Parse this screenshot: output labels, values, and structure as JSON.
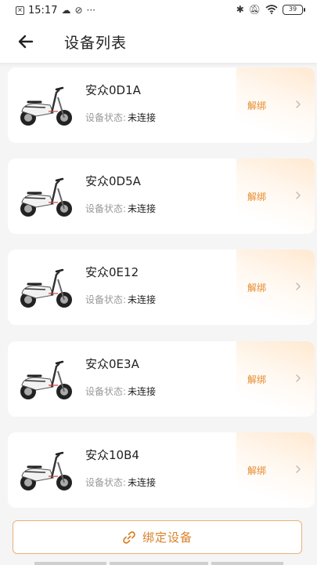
{
  "status_bar": {
    "time": "15:17",
    "extra": "···",
    "battery": "39"
  },
  "header": {
    "title": "设备列表"
  },
  "devices": [
    {
      "name": "安众0D1A",
      "status_label": "设备状态:",
      "status_value": "未连接",
      "unbind_label": "解绑"
    },
    {
      "name": "安众0D5A",
      "status_label": "设备状态:",
      "status_value": "未连接",
      "unbind_label": "解绑"
    },
    {
      "name": "安众0E12",
      "status_label": "设备状态:",
      "status_value": "未连接",
      "unbind_label": "解绑"
    },
    {
      "name": "安众0E3A",
      "status_label": "设备状态:",
      "status_value": "未连接",
      "unbind_label": "解绑"
    },
    {
      "name": "安众10B4",
      "status_label": "设备状态:",
      "status_value": "未连接",
      "unbind_label": "解绑"
    }
  ],
  "footer": {
    "bind_label": "绑定设备"
  },
  "icons": {
    "back": "arrow-left-icon",
    "chevron": "chevron-right-icon",
    "link": "link-icon",
    "scooter": "scooter-image"
  },
  "colors": {
    "accent": "#e58a2c",
    "button_border": "#e9b07a",
    "background": "#f5f5f5",
    "muted_text": "#999999"
  }
}
